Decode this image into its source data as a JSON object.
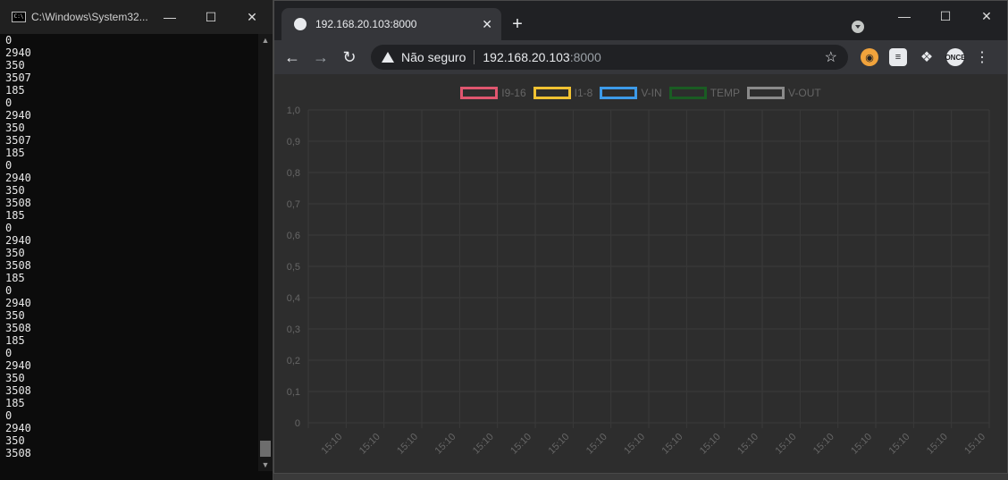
{
  "cmd": {
    "title": "C:\\Windows\\System32...",
    "icon_label": "C:\\",
    "lines": [
      "0",
      "2940",
      "350",
      "3507",
      "185",
      "0",
      "2940",
      "350",
      "3507",
      "185",
      "0",
      "2940",
      "350",
      "3508",
      "185",
      "0",
      "2940",
      "350",
      "3508",
      "185",
      "0",
      "2940",
      "350",
      "3508",
      "185",
      "0",
      "2940",
      "350",
      "3508",
      "185",
      "0",
      "2940",
      "350",
      "3508"
    ]
  },
  "browser": {
    "tab_title": "192.168.20.103:8000",
    "security_text": "Não seguro",
    "url_host": "192.168.20.103",
    "url_port": ":8000",
    "ext4_label": "ONCE"
  },
  "icons": {
    "minimize": "minimize-icon",
    "maximize": "maximize-icon",
    "close": "close-icon"
  },
  "chart_data": {
    "type": "line",
    "legend": [
      {
        "name": "I9-16",
        "color": "#e0566f"
      },
      {
        "name": "I1-8",
        "color": "#f1c232"
      },
      {
        "name": "V-IN",
        "color": "#3d9be9"
      },
      {
        "name": "TEMP",
        "color": "#1a5c23"
      },
      {
        "name": "V-OUT",
        "color": "#8a8a8a"
      }
    ],
    "y_ticks": [
      "1,0",
      "0,9",
      "0,8",
      "0,7",
      "0,6",
      "0,5",
      "0,4",
      "0,3",
      "0,2",
      "0,1",
      "0"
    ],
    "x_ticks": [
      "15:10",
      "15:10",
      "15:10",
      "15:10",
      "15:10",
      "15:10",
      "15:10",
      "15:10",
      "15:10",
      "15:10",
      "15:10",
      "15:10",
      "15:10",
      "15:10",
      "15:10",
      "15:10",
      "15:10",
      "15:10"
    ],
    "ylim": [
      0,
      1
    ],
    "grid": true,
    "legend_position": "top-center"
  }
}
